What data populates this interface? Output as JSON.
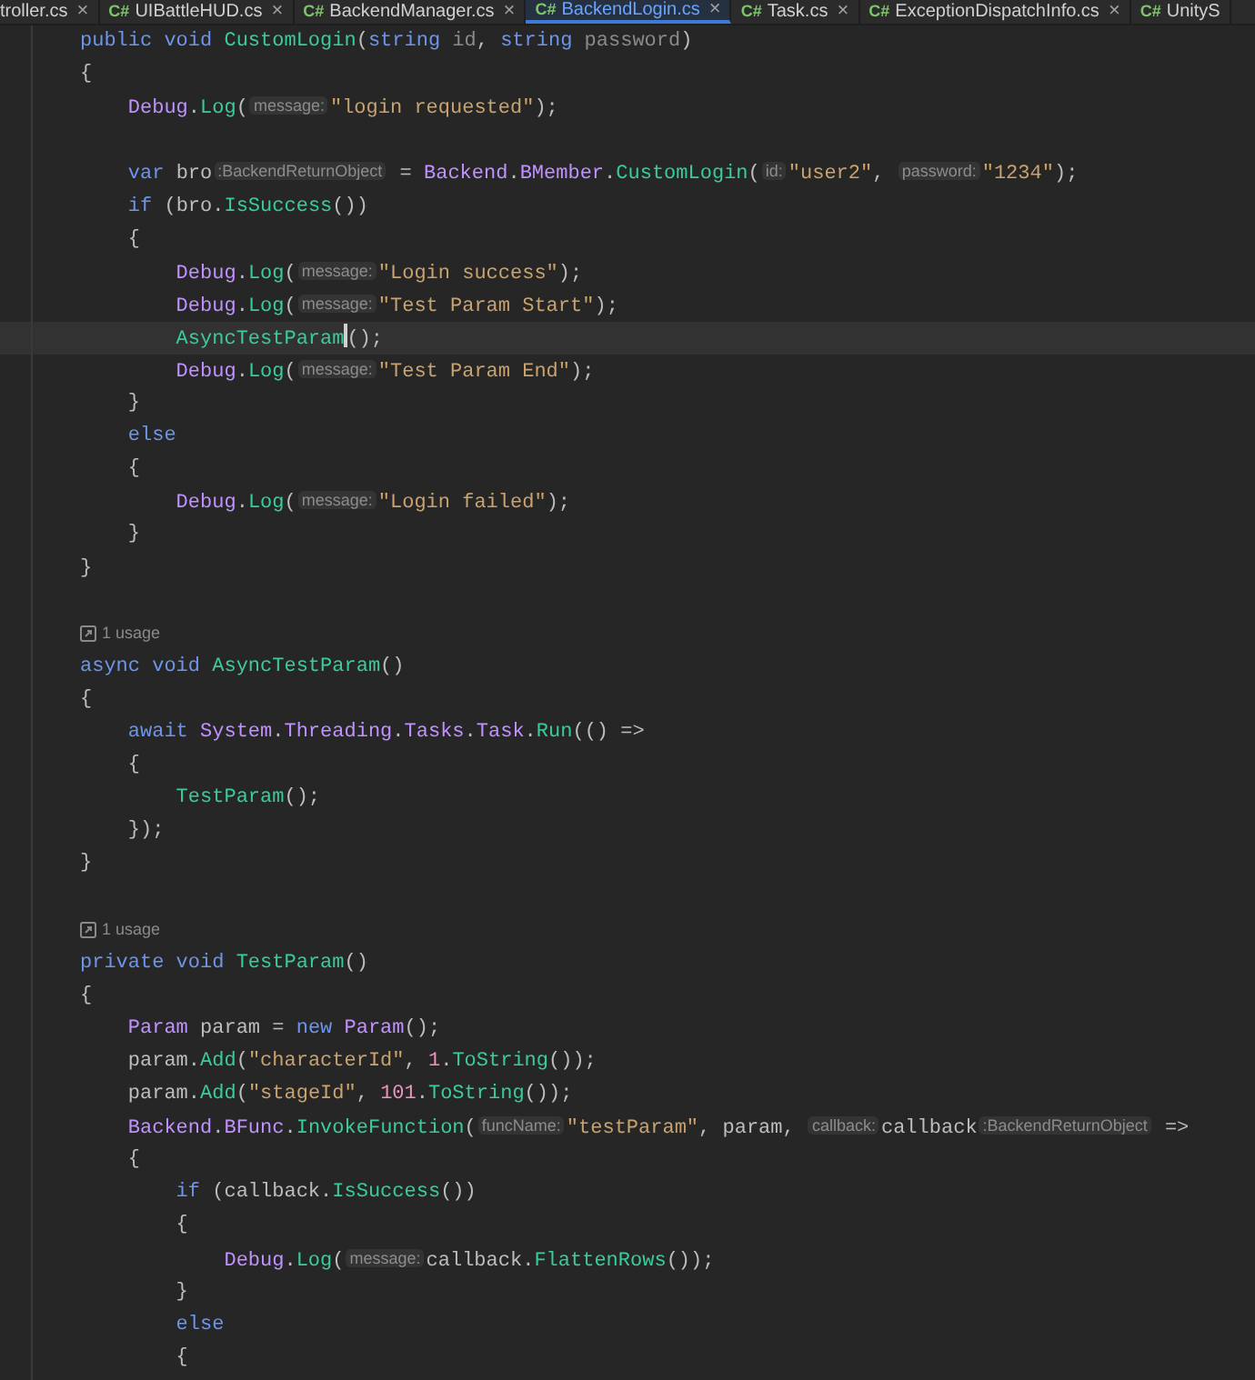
{
  "tabs": [
    {
      "label": "troller.cs",
      "selected": false,
      "closable": true
    },
    {
      "badge": "C#",
      "label": "UIBattleHUD.cs",
      "selected": false,
      "closable": true
    },
    {
      "badge": "C#",
      "label": "BackendManager.cs",
      "selected": false,
      "closable": true
    },
    {
      "badge": "C#",
      "label": "BackendLogin.cs",
      "selected": true,
      "closable": true
    },
    {
      "badge": "C#",
      "label": "Task.cs",
      "selected": false,
      "closable": true
    },
    {
      "badge": "C#",
      "label": "ExceptionDispatchInfo.cs",
      "selected": false,
      "closable": true
    },
    {
      "badge": "C#",
      "label": "UnityS",
      "selected": false,
      "closable": false
    }
  ],
  "close_glyph": "×",
  "lines": [
    {
      "kind": "code",
      "current": false,
      "tokens": [
        {
          "kind": "kw",
          "text": "public void "
        },
        {
          "kind": "method",
          "text": "CustomLogin"
        },
        {
          "kind": "plain",
          "text": "("
        },
        {
          "kind": "kw",
          "text": "string "
        },
        {
          "kind": "param",
          "text": "id"
        },
        {
          "kind": "plain",
          "text": ", "
        },
        {
          "kind": "kw",
          "text": "string "
        },
        {
          "kind": "param",
          "text": "password"
        },
        {
          "kind": "plain",
          "text": ")"
        }
      ]
    },
    {
      "kind": "code",
      "current": false,
      "tokens": [
        {
          "kind": "plain",
          "text": "{"
        }
      ]
    },
    {
      "kind": "code",
      "current": false,
      "tokens": [
        {
          "kind": "type",
          "text": "    Debug"
        },
        {
          "kind": "plain",
          "text": "."
        },
        {
          "kind": "method",
          "text": "Log"
        },
        {
          "kind": "plain",
          "text": "("
        },
        {
          "kind": "hint",
          "text": "message:"
        },
        {
          "kind": "str",
          "text": "\"login requested\""
        },
        {
          "kind": "plain",
          "text": ");"
        }
      ]
    },
    {
      "kind": "blank",
      "current": false
    },
    {
      "kind": "code",
      "current": false,
      "tokens": [
        {
          "kind": "kw",
          "text": "    var "
        },
        {
          "kind": "plain",
          "text": "bro"
        },
        {
          "kind": "hint",
          "text": ":BackendReturnObject"
        },
        {
          "kind": "plain",
          "text": " = "
        },
        {
          "kind": "type",
          "text": "Backend"
        },
        {
          "kind": "plain",
          "text": "."
        },
        {
          "kind": "type",
          "text": "BMember"
        },
        {
          "kind": "plain",
          "text": "."
        },
        {
          "kind": "method",
          "text": "CustomLogin"
        },
        {
          "kind": "plain",
          "text": "("
        },
        {
          "kind": "hint",
          "text": "id:"
        },
        {
          "kind": "str",
          "text": "\"user2\""
        },
        {
          "kind": "plain",
          "text": ", "
        },
        {
          "kind": "hint",
          "text": "password:"
        },
        {
          "kind": "str",
          "text": "\"1234\""
        },
        {
          "kind": "plain",
          "text": ");"
        }
      ]
    },
    {
      "kind": "code",
      "current": false,
      "tokens": [
        {
          "kind": "kw",
          "text": "    if "
        },
        {
          "kind": "plain",
          "text": "(bro."
        },
        {
          "kind": "method",
          "text": "IsSuccess"
        },
        {
          "kind": "plain",
          "text": "())"
        }
      ]
    },
    {
      "kind": "code",
      "current": false,
      "tokens": [
        {
          "kind": "plain",
          "text": "    {"
        }
      ]
    },
    {
      "kind": "code",
      "current": false,
      "tokens": [
        {
          "kind": "type",
          "text": "        Debug"
        },
        {
          "kind": "plain",
          "text": "."
        },
        {
          "kind": "method",
          "text": "Log"
        },
        {
          "kind": "plain",
          "text": "("
        },
        {
          "kind": "hint",
          "text": "message:"
        },
        {
          "kind": "str",
          "text": "\"Login success\""
        },
        {
          "kind": "plain",
          "text": ");"
        }
      ]
    },
    {
      "kind": "code",
      "current": false,
      "tokens": [
        {
          "kind": "type",
          "text": "        Debug"
        },
        {
          "kind": "plain",
          "text": "."
        },
        {
          "kind": "method",
          "text": "Log"
        },
        {
          "kind": "plain",
          "text": "("
        },
        {
          "kind": "hint",
          "text": "message:"
        },
        {
          "kind": "str",
          "text": "\"Test Param Start\""
        },
        {
          "kind": "plain",
          "text": ");"
        }
      ]
    },
    {
      "kind": "code",
      "current": true,
      "tokens": [
        {
          "kind": "method",
          "text": "        AsyncTestParam"
        },
        {
          "kind": "plain",
          "text": "();"
        }
      ]
    },
    {
      "kind": "code",
      "current": false,
      "tokens": [
        {
          "kind": "type",
          "text": "        Debug"
        },
        {
          "kind": "plain",
          "text": "."
        },
        {
          "kind": "method",
          "text": "Log"
        },
        {
          "kind": "plain",
          "text": "("
        },
        {
          "kind": "hint",
          "text": "message:"
        },
        {
          "kind": "str",
          "text": "\"Test Param End\""
        },
        {
          "kind": "plain",
          "text": ");"
        }
      ]
    },
    {
      "kind": "code",
      "current": false,
      "tokens": [
        {
          "kind": "plain",
          "text": "    }"
        }
      ]
    },
    {
      "kind": "code",
      "current": false,
      "tokens": [
        {
          "kind": "kw",
          "text": "    else"
        }
      ]
    },
    {
      "kind": "code",
      "current": false,
      "tokens": [
        {
          "kind": "plain",
          "text": "    {"
        }
      ]
    },
    {
      "kind": "code",
      "current": false,
      "tokens": [
        {
          "kind": "type",
          "text": "        Debug"
        },
        {
          "kind": "plain",
          "text": "."
        },
        {
          "kind": "method",
          "text": "Log"
        },
        {
          "kind": "plain",
          "text": "("
        },
        {
          "kind": "hint",
          "text": "message:"
        },
        {
          "kind": "str",
          "text": "\"Login failed\""
        },
        {
          "kind": "plain",
          "text": ");"
        }
      ]
    },
    {
      "kind": "code",
      "current": false,
      "tokens": [
        {
          "kind": "plain",
          "text": "    }"
        }
      ]
    },
    {
      "kind": "code",
      "current": false,
      "tokens": [
        {
          "kind": "plain",
          "text": "}"
        }
      ]
    },
    {
      "kind": "blank",
      "current": false
    },
    {
      "kind": "usage",
      "current": false,
      "text": "1 usage"
    },
    {
      "kind": "code",
      "current": false,
      "tokens": [
        {
          "kind": "kw",
          "text": "async void "
        },
        {
          "kind": "method",
          "text": "AsyncTestParam"
        },
        {
          "kind": "plain",
          "text": "()"
        }
      ]
    },
    {
      "kind": "code",
      "current": false,
      "tokens": [
        {
          "kind": "plain",
          "text": "{"
        }
      ]
    },
    {
      "kind": "code",
      "current": false,
      "tokens": [
        {
          "kind": "kw",
          "text": "    await "
        },
        {
          "kind": "type",
          "text": "System"
        },
        {
          "kind": "plain",
          "text": "."
        },
        {
          "kind": "type",
          "text": "Threading"
        },
        {
          "kind": "plain",
          "text": "."
        },
        {
          "kind": "type",
          "text": "Tasks"
        },
        {
          "kind": "plain",
          "text": "."
        },
        {
          "kind": "type",
          "text": "Task"
        },
        {
          "kind": "plain",
          "text": "."
        },
        {
          "kind": "method",
          "text": "Run"
        },
        {
          "kind": "plain",
          "text": "(() =>"
        }
      ]
    },
    {
      "kind": "code",
      "current": false,
      "tokens": [
        {
          "kind": "plain",
          "text": "    {"
        }
      ]
    },
    {
      "kind": "code",
      "current": false,
      "tokens": [
        {
          "kind": "method",
          "text": "        TestParam"
        },
        {
          "kind": "plain",
          "text": "();"
        }
      ]
    },
    {
      "kind": "code",
      "current": false,
      "tokens": [
        {
          "kind": "plain",
          "text": "    });"
        }
      ]
    },
    {
      "kind": "code",
      "current": false,
      "tokens": [
        {
          "kind": "plain",
          "text": "}"
        }
      ]
    },
    {
      "kind": "blank",
      "current": false
    },
    {
      "kind": "usage",
      "current": false,
      "text": "1 usage"
    },
    {
      "kind": "code",
      "current": false,
      "tokens": [
        {
          "kind": "kw",
          "text": "private void "
        },
        {
          "kind": "method",
          "text": "TestParam"
        },
        {
          "kind": "plain",
          "text": "()"
        }
      ]
    },
    {
      "kind": "code",
      "current": false,
      "tokens": [
        {
          "kind": "plain",
          "text": "{"
        }
      ]
    },
    {
      "kind": "code",
      "current": false,
      "tokens": [
        {
          "kind": "type",
          "text": "    Param"
        },
        {
          "kind": "plain",
          "text": " param = "
        },
        {
          "kind": "kw",
          "text": "new "
        },
        {
          "kind": "type",
          "text": "Param"
        },
        {
          "kind": "plain",
          "text": "();"
        }
      ]
    },
    {
      "kind": "code",
      "current": false,
      "tokens": [
        {
          "kind": "plain",
          "text": "    param."
        },
        {
          "kind": "method",
          "text": "Add"
        },
        {
          "kind": "plain",
          "text": "("
        },
        {
          "kind": "str",
          "text": "\"characterId\""
        },
        {
          "kind": "plain",
          "text": ", "
        },
        {
          "kind": "num",
          "text": "1"
        },
        {
          "kind": "plain",
          "text": "."
        },
        {
          "kind": "method",
          "text": "ToString"
        },
        {
          "kind": "plain",
          "text": "());"
        }
      ]
    },
    {
      "kind": "code",
      "current": false,
      "tokens": [
        {
          "kind": "plain",
          "text": "    param."
        },
        {
          "kind": "method",
          "text": "Add"
        },
        {
          "kind": "plain",
          "text": "("
        },
        {
          "kind": "str",
          "text": "\"stageId\""
        },
        {
          "kind": "plain",
          "text": ", "
        },
        {
          "kind": "num",
          "text": "101"
        },
        {
          "kind": "plain",
          "text": "."
        },
        {
          "kind": "method",
          "text": "ToString"
        },
        {
          "kind": "plain",
          "text": "());"
        }
      ]
    },
    {
      "kind": "code",
      "current": false,
      "tokens": [
        {
          "kind": "type",
          "text": "    Backend"
        },
        {
          "kind": "plain",
          "text": "."
        },
        {
          "kind": "type",
          "text": "BFunc"
        },
        {
          "kind": "plain",
          "text": "."
        },
        {
          "kind": "method",
          "text": "InvokeFunction"
        },
        {
          "kind": "plain",
          "text": "("
        },
        {
          "kind": "hint",
          "text": "funcName:"
        },
        {
          "kind": "str",
          "text": "\"testParam\""
        },
        {
          "kind": "plain",
          "text": ", param, "
        },
        {
          "kind": "hint",
          "text": "callback:"
        },
        {
          "kind": "plain",
          "text": "callback"
        },
        {
          "kind": "hint",
          "text": ":BackendReturnObject"
        },
        {
          "kind": "plain",
          "text": " =>"
        }
      ]
    },
    {
      "kind": "code",
      "current": false,
      "tokens": [
        {
          "kind": "plain",
          "text": "    {"
        }
      ]
    },
    {
      "kind": "code",
      "current": false,
      "tokens": [
        {
          "kind": "kw",
          "text": "        if "
        },
        {
          "kind": "plain",
          "text": "(callback."
        },
        {
          "kind": "method",
          "text": "IsSuccess"
        },
        {
          "kind": "plain",
          "text": "())"
        }
      ]
    },
    {
      "kind": "code",
      "current": false,
      "tokens": [
        {
          "kind": "plain",
          "text": "        {"
        }
      ]
    },
    {
      "kind": "code",
      "current": false,
      "tokens": [
        {
          "kind": "type",
          "text": "            Debug"
        },
        {
          "kind": "plain",
          "text": "."
        },
        {
          "kind": "method",
          "text": "Log"
        },
        {
          "kind": "plain",
          "text": "("
        },
        {
          "kind": "hint",
          "text": "message:"
        },
        {
          "kind": "plain",
          "text": "callback."
        },
        {
          "kind": "method",
          "text": "FlattenRows"
        },
        {
          "kind": "plain",
          "text": "());"
        }
      ]
    },
    {
      "kind": "code",
      "current": false,
      "tokens": [
        {
          "kind": "plain",
          "text": "        }"
        }
      ]
    },
    {
      "kind": "code",
      "current": false,
      "tokens": [
        {
          "kind": "kw",
          "text": "        else"
        }
      ]
    },
    {
      "kind": "code",
      "current": false,
      "tokens": [
        {
          "kind": "plain",
          "text": "        {"
        }
      ]
    }
  ]
}
